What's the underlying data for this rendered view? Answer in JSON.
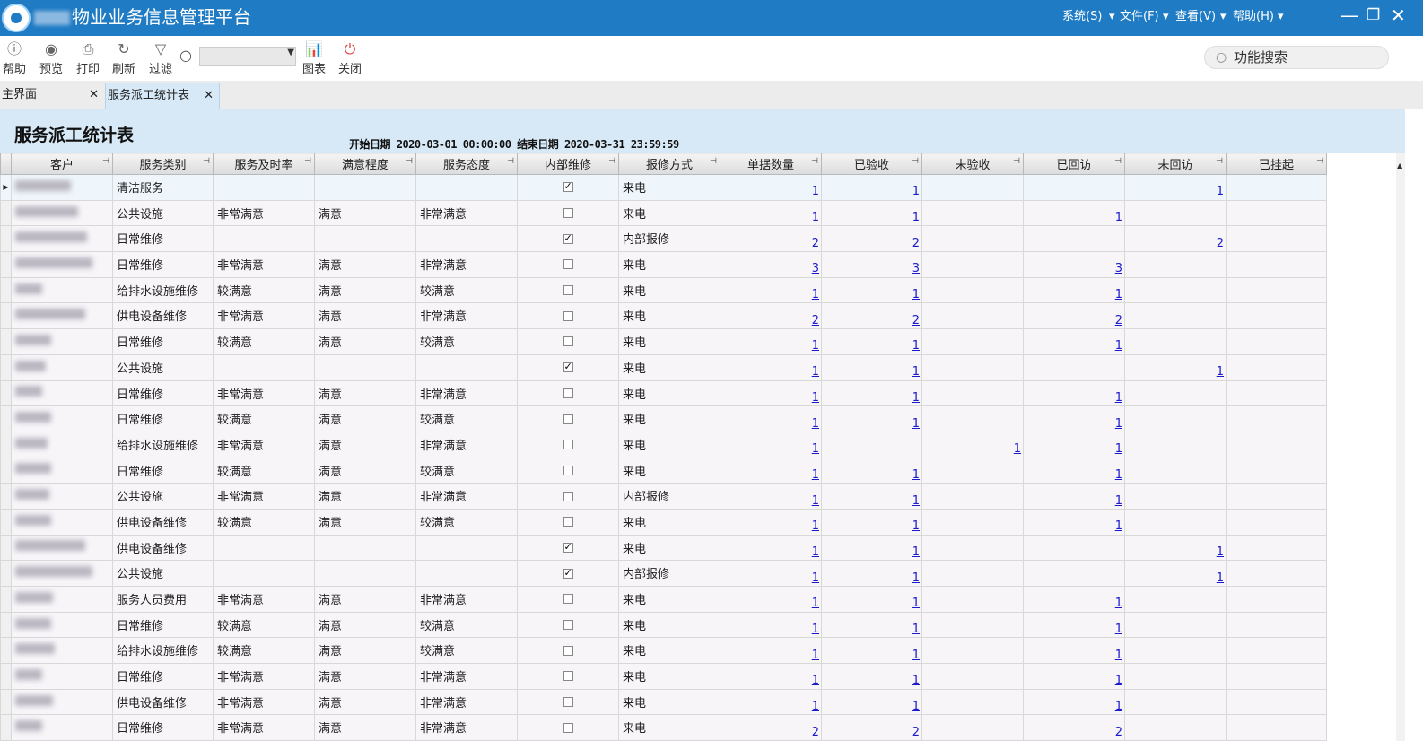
{
  "app": {
    "title": "物业业务信息管理平台",
    "menus": [
      "系统(S)",
      "文件(F)",
      "查看(V)",
      "帮助(H)"
    ]
  },
  "toolbar": {
    "help": "帮助",
    "preview": "预览",
    "print": "打印",
    "refresh": "刷新",
    "filter": "过滤",
    "chart": "图表",
    "close": "关闭",
    "search_value": "",
    "func_search": "功能搜索"
  },
  "tabs": [
    {
      "label": "主界面"
    },
    {
      "label": "服务派工统计表"
    }
  ],
  "report": {
    "title": "服务派工统计表",
    "range": "开始日期 2020-03-01 00:00:00 结束日期 2020-03-31 23:59:59"
  },
  "table": {
    "columns": [
      "客户",
      "服务类别",
      "服务及时率",
      "满意程度",
      "服务态度",
      "内部维修",
      "报修方式",
      "单据数量",
      "已验收",
      "未验收",
      "已回访",
      "未回访",
      "已挂起"
    ],
    "rows": [
      {
        "category": "清洁服务",
        "timely": "",
        "satisfaction": "",
        "attitude": "",
        "internal": true,
        "method": "来电",
        "count": "1",
        "accepted": "1",
        "unaccepted": "",
        "visited": "",
        "unvisited": "1",
        "suspended": ""
      },
      {
        "category": "公共设施",
        "timely": "非常满意",
        "satisfaction": "满意",
        "attitude": "非常满意",
        "internal": false,
        "method": "来电",
        "count": "1",
        "accepted": "1",
        "unaccepted": "",
        "visited": "1",
        "unvisited": "",
        "suspended": ""
      },
      {
        "category": "日常维修",
        "timely": "",
        "satisfaction": "",
        "attitude": "",
        "internal": true,
        "method": "内部报修",
        "count": "2",
        "accepted": "2",
        "unaccepted": "",
        "visited": "",
        "unvisited": "2",
        "suspended": ""
      },
      {
        "category": "日常维修",
        "timely": "非常满意",
        "satisfaction": "满意",
        "attitude": "非常满意",
        "internal": false,
        "method": "来电",
        "count": "3",
        "accepted": "3",
        "unaccepted": "",
        "visited": "3",
        "unvisited": "",
        "suspended": ""
      },
      {
        "category": "给排水设施维修",
        "timely": "较满意",
        "satisfaction": "满意",
        "attitude": "较满意",
        "internal": false,
        "method": "来电",
        "count": "1",
        "accepted": "1",
        "unaccepted": "",
        "visited": "1",
        "unvisited": "",
        "suspended": ""
      },
      {
        "category": "供电设备维修",
        "timely": "非常满意",
        "satisfaction": "满意",
        "attitude": "非常满意",
        "internal": false,
        "method": "来电",
        "count": "2",
        "accepted": "2",
        "unaccepted": "",
        "visited": "2",
        "unvisited": "",
        "suspended": ""
      },
      {
        "category": "日常维修",
        "timely": "较满意",
        "satisfaction": "满意",
        "attitude": "较满意",
        "internal": false,
        "method": "来电",
        "count": "1",
        "accepted": "1",
        "unaccepted": "",
        "visited": "1",
        "unvisited": "",
        "suspended": ""
      },
      {
        "category": "公共设施",
        "timely": "",
        "satisfaction": "",
        "attitude": "",
        "internal": true,
        "method": "来电",
        "count": "1",
        "accepted": "1",
        "unaccepted": "",
        "visited": "",
        "unvisited": "1",
        "suspended": ""
      },
      {
        "category": "日常维修",
        "timely": "非常满意",
        "satisfaction": "满意",
        "attitude": "非常满意",
        "internal": false,
        "method": "来电",
        "count": "1",
        "accepted": "1",
        "unaccepted": "",
        "visited": "1",
        "unvisited": "",
        "suspended": ""
      },
      {
        "category": "日常维修",
        "timely": "较满意",
        "satisfaction": "满意",
        "attitude": "较满意",
        "internal": false,
        "method": "来电",
        "count": "1",
        "accepted": "1",
        "unaccepted": "",
        "visited": "1",
        "unvisited": "",
        "suspended": ""
      },
      {
        "category": "给排水设施维修",
        "timely": "非常满意",
        "satisfaction": "满意",
        "attitude": "非常满意",
        "internal": false,
        "method": "来电",
        "count": "1",
        "accepted": "",
        "unaccepted": "1",
        "visited": "1",
        "unvisited": "",
        "suspended": ""
      },
      {
        "category": "日常维修",
        "timely": "较满意",
        "satisfaction": "满意",
        "attitude": "较满意",
        "internal": false,
        "method": "来电",
        "count": "1",
        "accepted": "1",
        "unaccepted": "",
        "visited": "1",
        "unvisited": "",
        "suspended": ""
      },
      {
        "category": "公共设施",
        "timely": "非常满意",
        "satisfaction": "满意",
        "attitude": "非常满意",
        "internal": false,
        "method": "内部报修",
        "count": "1",
        "accepted": "1",
        "unaccepted": "",
        "visited": "1",
        "unvisited": "",
        "suspended": ""
      },
      {
        "category": "供电设备维修",
        "timely": "较满意",
        "satisfaction": "满意",
        "attitude": "较满意",
        "internal": false,
        "method": "来电",
        "count": "1",
        "accepted": "1",
        "unaccepted": "",
        "visited": "1",
        "unvisited": "",
        "suspended": ""
      },
      {
        "category": "供电设备维修",
        "timely": "",
        "satisfaction": "",
        "attitude": "",
        "internal": true,
        "method": "来电",
        "count": "1",
        "accepted": "1",
        "unaccepted": "",
        "visited": "",
        "unvisited": "1",
        "suspended": ""
      },
      {
        "category": "公共设施",
        "timely": "",
        "satisfaction": "",
        "attitude": "",
        "internal": true,
        "method": "内部报修",
        "count": "1",
        "accepted": "1",
        "unaccepted": "",
        "visited": "",
        "unvisited": "1",
        "suspended": ""
      },
      {
        "category": "服务人员费用",
        "timely": "非常满意",
        "satisfaction": "满意",
        "attitude": "非常满意",
        "internal": false,
        "method": "来电",
        "count": "1",
        "accepted": "1",
        "unaccepted": "",
        "visited": "1",
        "unvisited": "",
        "suspended": ""
      },
      {
        "category": "日常维修",
        "timely": "较满意",
        "satisfaction": "满意",
        "attitude": "较满意",
        "internal": false,
        "method": "来电",
        "count": "1",
        "accepted": "1",
        "unaccepted": "",
        "visited": "1",
        "unvisited": "",
        "suspended": ""
      },
      {
        "category": "给排水设施维修",
        "timely": "较满意",
        "satisfaction": "满意",
        "attitude": "较满意",
        "internal": false,
        "method": "来电",
        "count": "1",
        "accepted": "1",
        "unaccepted": "",
        "visited": "1",
        "unvisited": "",
        "suspended": ""
      },
      {
        "category": "日常维修",
        "timely": "非常满意",
        "satisfaction": "满意",
        "attitude": "非常满意",
        "internal": false,
        "method": "来电",
        "count": "1",
        "accepted": "1",
        "unaccepted": "",
        "visited": "1",
        "unvisited": "",
        "suspended": ""
      },
      {
        "category": "供电设备维修",
        "timely": "非常满意",
        "satisfaction": "满意",
        "attitude": "非常满意",
        "internal": false,
        "method": "来电",
        "count": "1",
        "accepted": "1",
        "unaccepted": "",
        "visited": "1",
        "unvisited": "",
        "suspended": ""
      },
      {
        "category": "日常维修",
        "timely": "非常满意",
        "satisfaction": "满意",
        "attitude": "非常满意",
        "internal": false,
        "method": "来电",
        "count": "2",
        "accepted": "2",
        "unaccepted": "",
        "visited": "2",
        "unvisited": "",
        "suspended": ""
      }
    ]
  }
}
